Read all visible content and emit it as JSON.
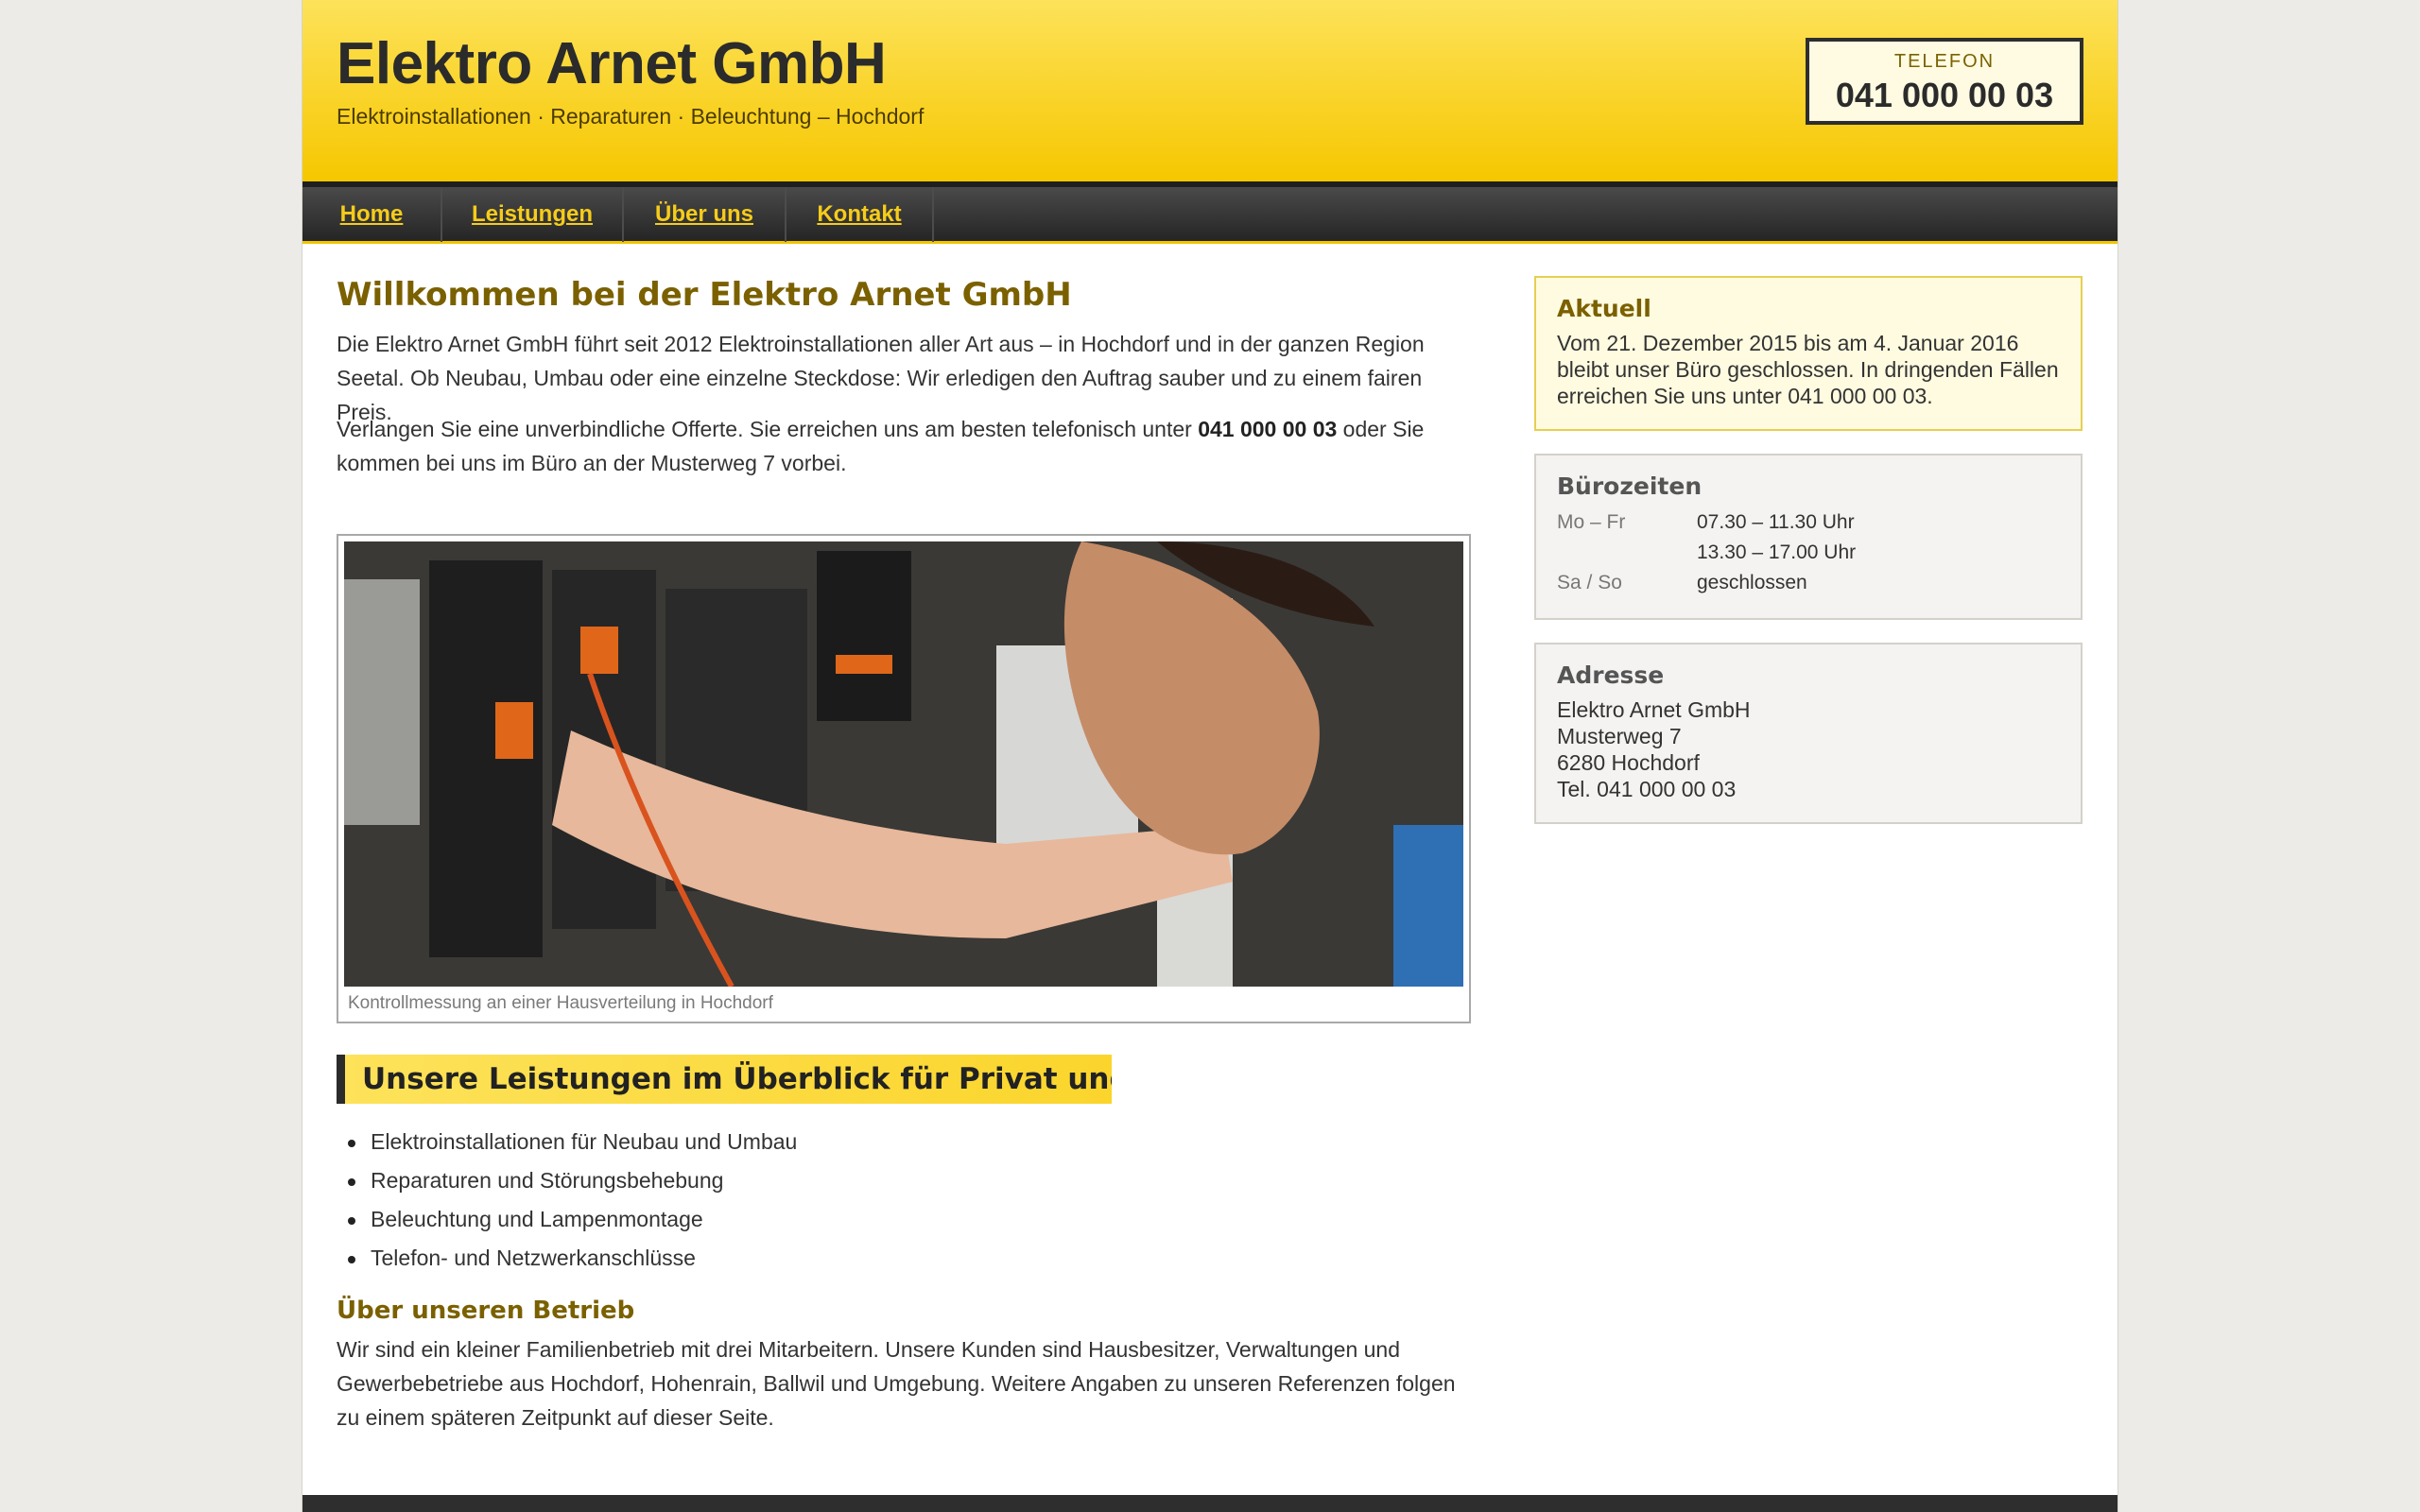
{
  "header": {
    "site_title": "Elektro Arnet GmbH",
    "tagline": "Elektroinstallationen · Reparaturen · Beleuchtung – Hochdorf",
    "phone_label": "TELEFON",
    "phone_number": "041 000 00 03"
  },
  "nav": {
    "items": [
      {
        "label": "Home"
      },
      {
        "label": "Leistungen"
      },
      {
        "label": "Über uns"
      },
      {
        "label": "Kontakt"
      }
    ]
  },
  "main": {
    "title": "Willkommen bei der Elektro Arnet GmbH",
    "intro": "Die Elektro Arnet GmbH führt seit 2012 Elektroinstallationen aller Art aus – in Hochdorf und in der ganzen Region Seetal. Ob Neubau, Umbau oder eine einzelne Steckdose: Wir erledigen den Auftrag sauber und zu einem fairen Preis.",
    "offer_text_before": "Verlangen Sie eine unverbindliche Offerte. Sie erreichen uns am besten telefonisch unter ",
    "offer_phone": "041 000 00 03",
    "offer_text_after": " oder Sie kommen bei uns im Büro an der Musterweg 7 vorbei.",
    "figure_caption": "Kontrollmessung an einer Hausverteilung in Hochdorf",
    "services_heading": "Unsere Leistungen im Überblick für Privat und Gewe",
    "services": [
      "Elektroinstallationen für Neubau und Umbau",
      "Reparaturen und Störungsbehebung",
      "Beleuchtung und Lampenmontage",
      "Telefon- und Netzwerkanschlüsse"
    ],
    "about_heading": "Über unseren Betrieb",
    "about_text": "Wir sind ein kleiner Familienbetrieb mit drei Mitarbeitern. Unsere Kunden sind Hausbesitzer, Verwaltungen und Gewerbebetriebe aus Hochdorf, Hohenrain, Ballwil und Umgebung. Weitere Angaben zu unseren Referenzen folgen zu einem späteren Zeitpunkt auf dieser Seite."
  },
  "sidebar": {
    "news": {
      "title": "Aktuell",
      "text": "Vom 21. Dezember 2015 bis am 4. Januar 2016 bleibt unser Büro geschlossen. In dringenden Fällen erreichen Sie uns unter 041 000 00 03."
    },
    "hours": {
      "title": "Bürozeiten",
      "rows": [
        {
          "day": "Mo – Fr",
          "time": "07.30 – 11.30 Uhr"
        },
        {
          "day": "",
          "time": "13.30 – 17.00 Uhr"
        },
        {
          "day": "Sa / So",
          "time": "geschlossen"
        }
      ]
    },
    "address": {
      "title": "Adresse",
      "lines": [
        "Elektro Arnet GmbH",
        "Musterweg 7",
        "6280 Hochdorf",
        "Tel. 041 000 00 03"
      ]
    }
  }
}
